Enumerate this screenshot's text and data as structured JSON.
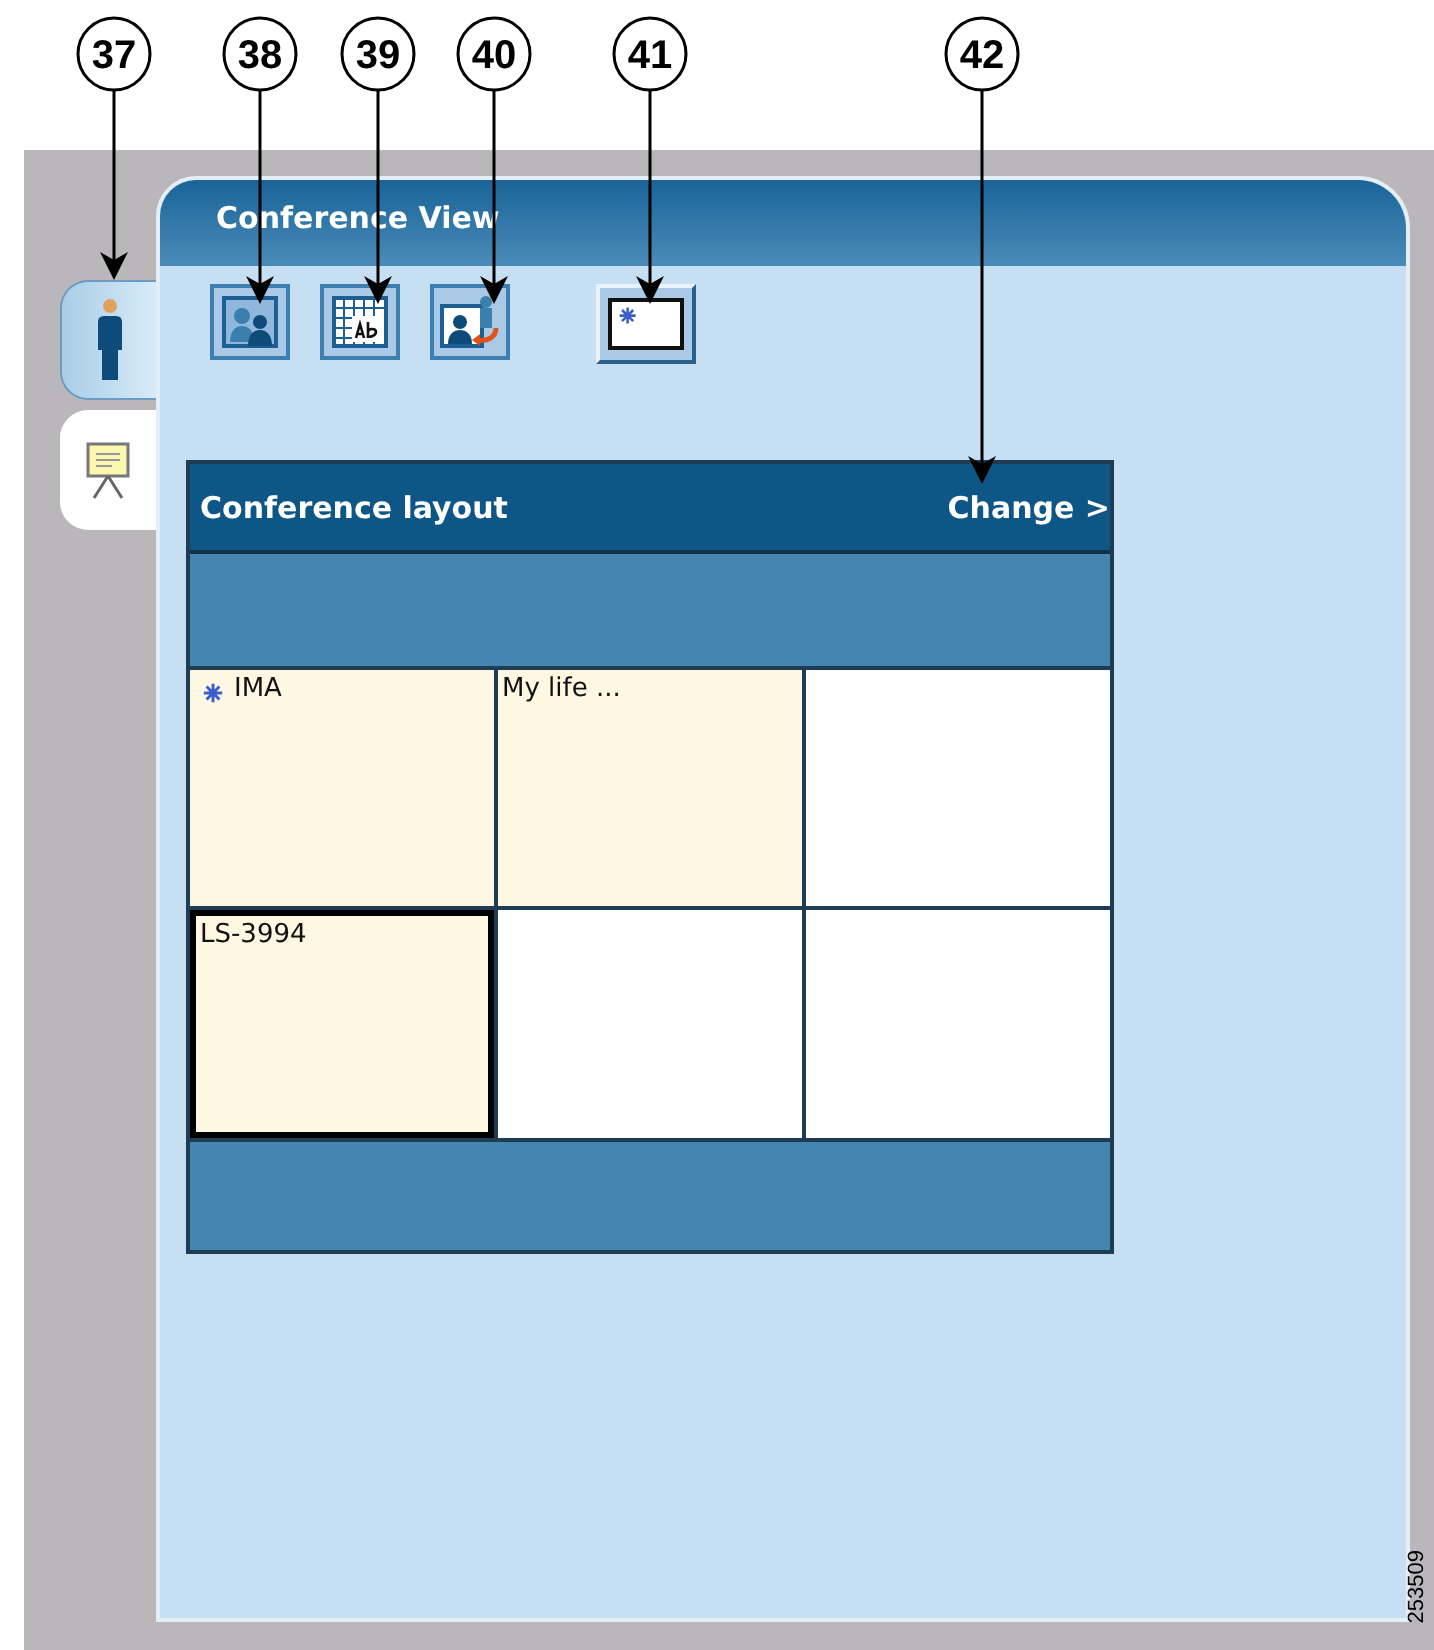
{
  "callouts": [
    {
      "label": "37"
    },
    {
      "label": "38"
    },
    {
      "label": "39"
    },
    {
      "label": "40"
    },
    {
      "label": "41"
    },
    {
      "label": "42"
    }
  ],
  "side_tabs": [
    {
      "kind": "participant",
      "selected": true
    },
    {
      "kind": "presentation",
      "selected": false
    }
  ],
  "panel": {
    "title": "Conference View"
  },
  "toolbar": [
    {
      "kind": "people"
    },
    {
      "kind": "grid-text"
    },
    {
      "kind": "swap"
    },
    {
      "kind": "marked-frame"
    }
  ],
  "layout": {
    "title": "Conference layout",
    "change_link": "Change >",
    "cells": [
      {
        "label": "IMA",
        "occupied": true,
        "selected": false,
        "marked": true
      },
      {
        "label": "My life ...",
        "occupied": true,
        "selected": false,
        "marked": false
      },
      {
        "occupied": false,
        "selected": false,
        "marked": false
      },
      {
        "label": "LS-3994",
        "occupied": true,
        "selected": true,
        "marked": false
      },
      {
        "occupied": false,
        "selected": false,
        "marked": false
      },
      {
        "occupied": false,
        "selected": false,
        "marked": false
      }
    ]
  },
  "figure_id": "253509"
}
